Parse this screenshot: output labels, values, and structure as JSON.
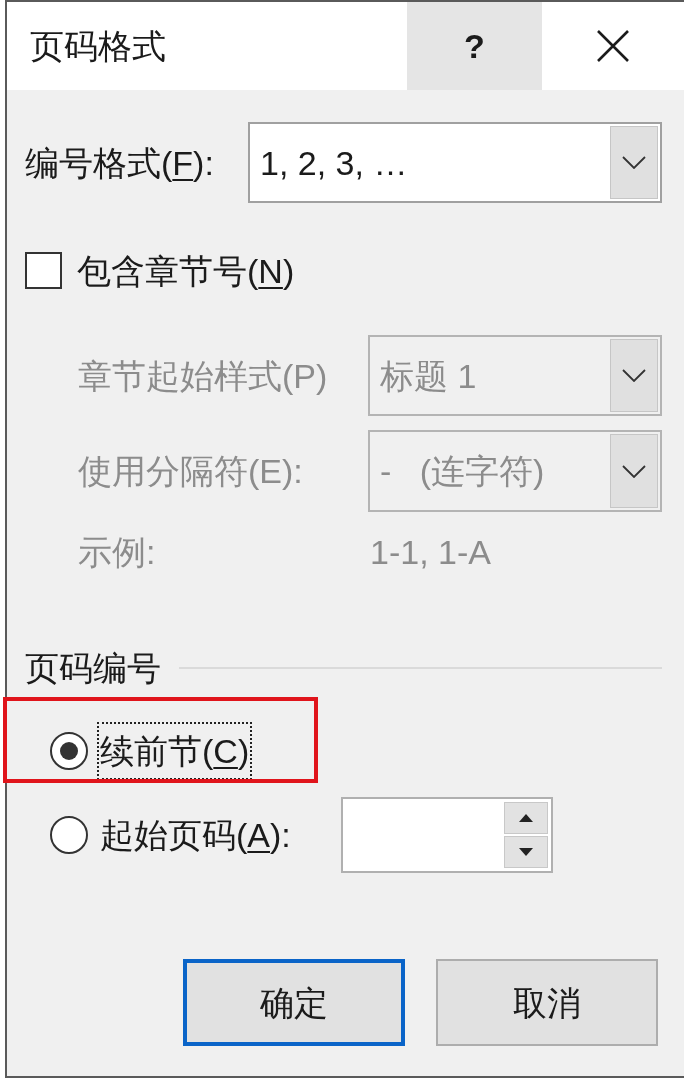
{
  "window": {
    "title": "页码格式",
    "help_button": "?"
  },
  "number_format": {
    "label": [
      {
        "text": "编号格式("
      },
      {
        "text": "F",
        "access_key": true
      },
      {
        "text": "):"
      }
    ],
    "value": "1, 2, 3, …"
  },
  "include_chapter_number": {
    "label": [
      {
        "text": "包含章节号("
      },
      {
        "text": "N",
        "access_key": true
      },
      {
        "text": ")"
      }
    ],
    "checked": false
  },
  "chapter_fields": [
    {
      "kind": "dropdown",
      "label": "章节起始样式(P)",
      "value": "标题 1",
      "disabled": true
    },
    {
      "kind": "dropdown",
      "label": "使用分隔符(E):",
      "value": "-   (连字符)",
      "disabled": true
    },
    {
      "kind": "example",
      "label": "示例:",
      "value": "1-1, 1-A",
      "disabled": true
    }
  ],
  "page_numbering": {
    "heading": "页码编号",
    "options": [
      {
        "kind": "plain",
        "label": [
          {
            "text": "续前节("
          },
          {
            "text": "C",
            "access_key": true
          },
          {
            "text": ")"
          }
        ],
        "selected": true,
        "focused": true,
        "highlighted": true
      },
      {
        "kind": "spin_field",
        "label": [
          {
            "text": "起始页码("
          },
          {
            "text": "A",
            "access_key": true
          },
          {
            "text": "):"
          }
        ],
        "selected": false,
        "focused": false,
        "highlighted": false
      }
    ]
  },
  "buttons": [
    {
      "label": "确定",
      "default": true
    },
    {
      "label": "取消",
      "default": false
    }
  ]
}
